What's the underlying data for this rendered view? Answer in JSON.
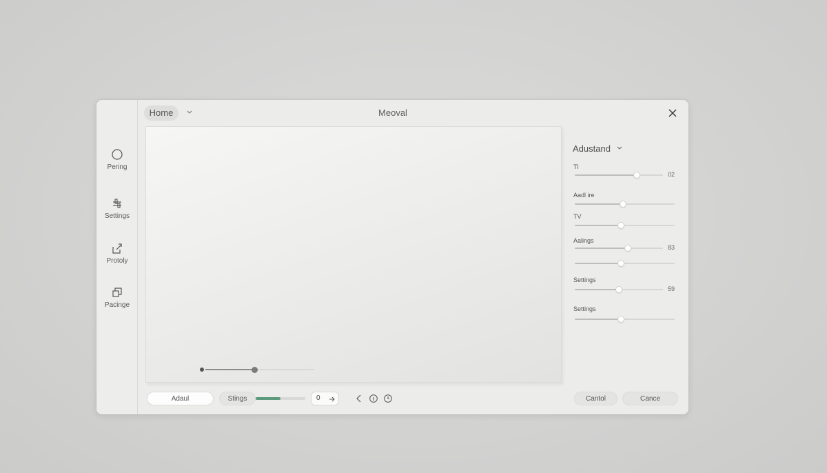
{
  "window": {
    "title": "Meoval",
    "home_tab": "Home"
  },
  "rail": {
    "items": [
      {
        "label": "Pering",
        "icon": "circle-icon"
      },
      {
        "label": "Settings",
        "icon": "sliders-icon"
      },
      {
        "label": "Protoly",
        "icon": "export-icon"
      },
      {
        "label": "Pacinge",
        "icon": "layers-icon"
      }
    ]
  },
  "canvas": {
    "slider_value": 0.45
  },
  "panel": {
    "title": "Adustand",
    "params": [
      {
        "label": "Tl",
        "value": 0.7,
        "readout": "02"
      },
      {
        "label": "Aadl ire",
        "value": 0.48,
        "readout": ""
      },
      {
        "label": "TV",
        "value": 0.46,
        "readout": ""
      },
      {
        "label": "Aalings",
        "value": 0.6,
        "readout": "83",
        "second_value": 0.46
      },
      {
        "label": "Settings",
        "value": 0.5,
        "readout": "59"
      },
      {
        "label": "Settings",
        "value": 0.46,
        "readout": ""
      }
    ]
  },
  "bottom": {
    "left_button": "Adaul",
    "settings_button": "Stings",
    "progress": 0.5,
    "number_value": "0",
    "cancel_button": "Cantol",
    "cancel2_button": "Cance"
  },
  "colors": {
    "accent_green": "#5e9a7d"
  }
}
